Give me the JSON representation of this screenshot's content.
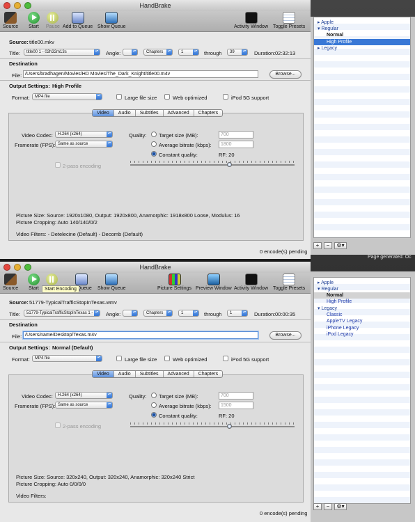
{
  "window1": {
    "title": "HandBrake",
    "toolbar": {
      "source": "Source",
      "start": "Start",
      "pause": "Pause",
      "add_to_queue": "Add to Queue",
      "show_queue": "Show Queue",
      "activity_window": "Activity Window",
      "toggle_presets": "Toggle Presets"
    },
    "source_label": "Source:",
    "source_value": "title00.mkv",
    "title_label": "Title:",
    "title_value": "title00 1 - 02h32m13s",
    "angle_label": "Angle:",
    "angle_value": "",
    "chapters_value": "Chapters",
    "chapter_from": "1",
    "through_label": "through",
    "chapter_to": "39",
    "duration_label": "Duration:",
    "duration_value": "02:32:13",
    "destination_label": "Destination",
    "file_label": "File:",
    "file_value": "/Users/bradhagen/Movies/HD Movies/The_Dark_Knight/title00.m4v",
    "browse": "Browse...",
    "output_settings_label": "Output Settings:",
    "output_settings_value": "High Profile",
    "format_label": "Format:",
    "format_value": "MP4 file",
    "large_file": "Large file size",
    "web_optimized": "Web optimized",
    "ipod": "iPod 5G support",
    "tabs": [
      "Video",
      "Audio",
      "Subtitles",
      "Advanced",
      "Chapters"
    ],
    "video_codec_label": "Video Codec:",
    "video_codec_value": "H.264 (x264)",
    "framerate_label": "Framerate (FPS):",
    "framerate_value": "Same as source",
    "two_pass": "2-pass encoding",
    "quality_label": "Quality:",
    "target_size": "Target size (MB):",
    "target_size_value": "700",
    "avg_bitrate": "Average bitrate (kbps):",
    "avg_bitrate_value": "1800",
    "constant_quality": "Constant quality:",
    "rf": "RF:  20",
    "picture_size": "Picture Size: Source: 1920x1080, Output: 1920x800, Anamorphic: 1918x800 Loose, Modulus: 16",
    "picture_cropping": "Picture Cropping: Auto 140/140/0/2",
    "video_filters": "Video Filters:   - Detelecine (Default) - Decomb (Default)",
    "pending": "0 encode(s) pending"
  },
  "window2": {
    "title": "HandBrake",
    "toolbar": {
      "source": "Source",
      "start": "Start",
      "add_to_queue": "to Queue",
      "show_queue": "Show Queue",
      "picture_settings": "Picture Settings",
      "preview_window": "Preview Window",
      "activity_window": "Activity Window",
      "toggle_presets": "Toggle Presets"
    },
    "tooltip": "Start Encoding",
    "source_label": "Source:",
    "source_value": "51779-TypicalTrafficStopInTexas.wmv",
    "title_label": "Title:",
    "title_value": "51779-TypicalTrafficStopInTexas 1 -",
    "angle_label": "Angle:",
    "angle_value": "",
    "chapters_value": "Chapters",
    "chapter_from": "1",
    "through_label": "through",
    "chapter_to": "1",
    "duration_label": "Duration:",
    "duration_value": "00:00:35",
    "destination_label": "Destination",
    "file_label": "File:",
    "file_value": "/Users/name/Desktop/Texas.m4v",
    "browse": "Browse...",
    "output_settings_label": "Output Settings:",
    "output_settings_value": "Normal (Default)",
    "format_label": "Format:",
    "format_value": "MP4 file",
    "large_file": "Large file size",
    "web_optimized": "Web optimized",
    "ipod": "iPod 5G support",
    "tabs": [
      "Video",
      "Audio",
      "Subtitles",
      "Advanced",
      "Chapters"
    ],
    "video_codec_label": "Video Codec:",
    "video_codec_value": "H.264 (x264)",
    "framerate_label": "Framerate (FPS):",
    "framerate_value": "Same as source",
    "two_pass": "2-pass encoding",
    "quality_label": "Quality:",
    "target_size": "Target size (MB):",
    "target_size_value": "700",
    "avg_bitrate": "Average bitrate (kbps):",
    "avg_bitrate_value": "1500",
    "constant_quality": "Constant quality:",
    "rf": "RF:  20",
    "picture_size": "Picture Size: Source: 320x240, Output: 320x240, Anamorphic: 320x240 Strict",
    "picture_cropping": "Picture Cropping: Auto 0/0/0/0",
    "video_filters": "Video Filters:",
    "pending": "0 encode(s) pending"
  },
  "presets1": [
    "Apple",
    "Regular",
    "Normal",
    "High Profile",
    "Legacy"
  ],
  "presets2": [
    "Apple",
    "Regular",
    "Normal",
    "High Profile",
    "Legacy",
    "Classic",
    "AppleTV Legacy",
    "iPhone Legacy",
    "iPod Legacy"
  ],
  "page_generated": "Page generated: Oc",
  "drawer_buttons": {
    "add": "+",
    "remove": "−",
    "gear": "⚙▾"
  },
  "colors": {
    "selection": "#3978d6",
    "link_blue": "#1c3f96",
    "start_green": "#1f8c2a"
  }
}
